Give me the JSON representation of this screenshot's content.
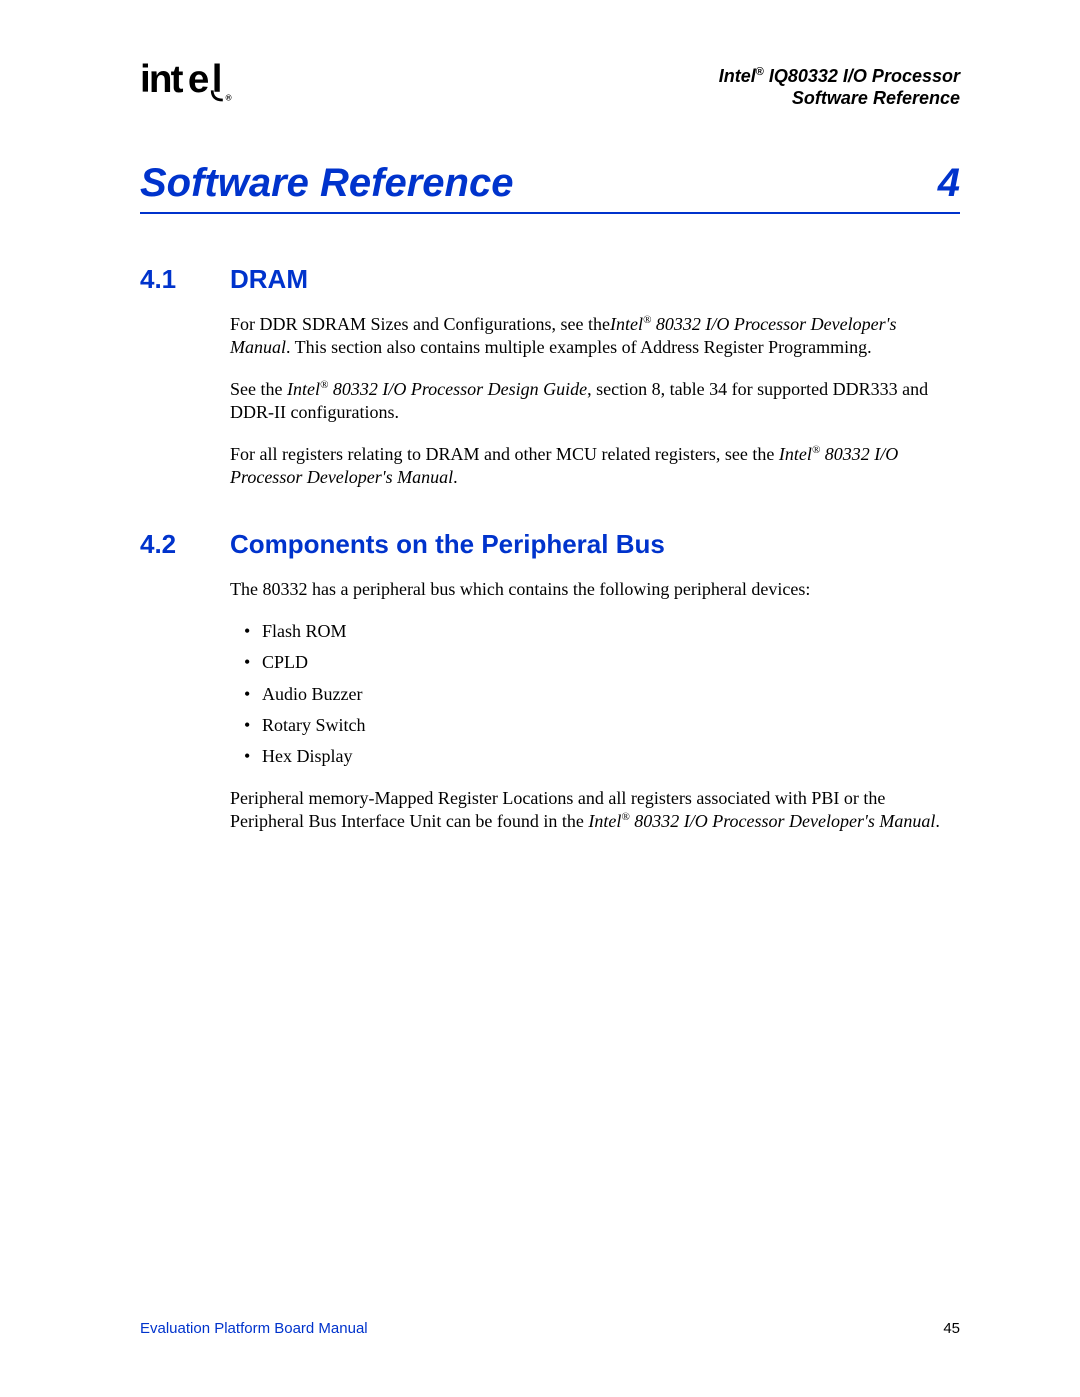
{
  "header": {
    "logo_text": "intel",
    "logo_reg": "®",
    "product_line_prefix": "Intel",
    "product_line_reg": "®",
    "product_line_suffix": " IQ80332 I/O Processor",
    "subtitle": "Software Reference"
  },
  "chapter": {
    "title": "Software Reference",
    "number": "4"
  },
  "sections": [
    {
      "num": "4.1",
      "title": "DRAM",
      "paragraphs": [
        {
          "pre": "For DDR SDRAM Sizes and Configurations, see the",
          "ital_prefix": "Intel",
          "ital_reg": "®",
          "ital_suffix": " 80332 I/O Processor Developer's Manual",
          "post": ". This section also contains multiple examples of Address Register Programming."
        },
        {
          "pre": "See the ",
          "ital_prefix": "Intel",
          "ital_reg": "®",
          "ital_suffix": " 80332 I/O Processor Design Guide",
          "post": ", section 8, table 34 for supported DDR333 and DDR-II configurations."
        },
        {
          "pre": "For all registers relating to DRAM and other MCU related registers, see the ",
          "ital_prefix": "Intel",
          "ital_reg": "®",
          "ital_suffix": " 80332 I/O Processor Developer's Manual",
          "post": "."
        }
      ]
    },
    {
      "num": "4.2",
      "title": "Components on the Peripheral Bus",
      "intro": "The 80332 has a peripheral bus which contains the following peripheral devices:",
      "bullets": [
        "Flash ROM",
        "CPLD",
        "Audio Buzzer",
        "Rotary Switch",
        "Hex Display"
      ],
      "closing": {
        "pre": "Peripheral memory-Mapped Register Locations and all registers associated with PBI or the Peripheral Bus Interface Unit can be found in the ",
        "ital_prefix": "Intel",
        "ital_reg": "®",
        "ital_suffix": " 80332 I/O Processor Developer's Manual",
        "post": "."
      }
    }
  ],
  "footer": {
    "left": "Evaluation Platform Board Manual",
    "right": "45"
  }
}
